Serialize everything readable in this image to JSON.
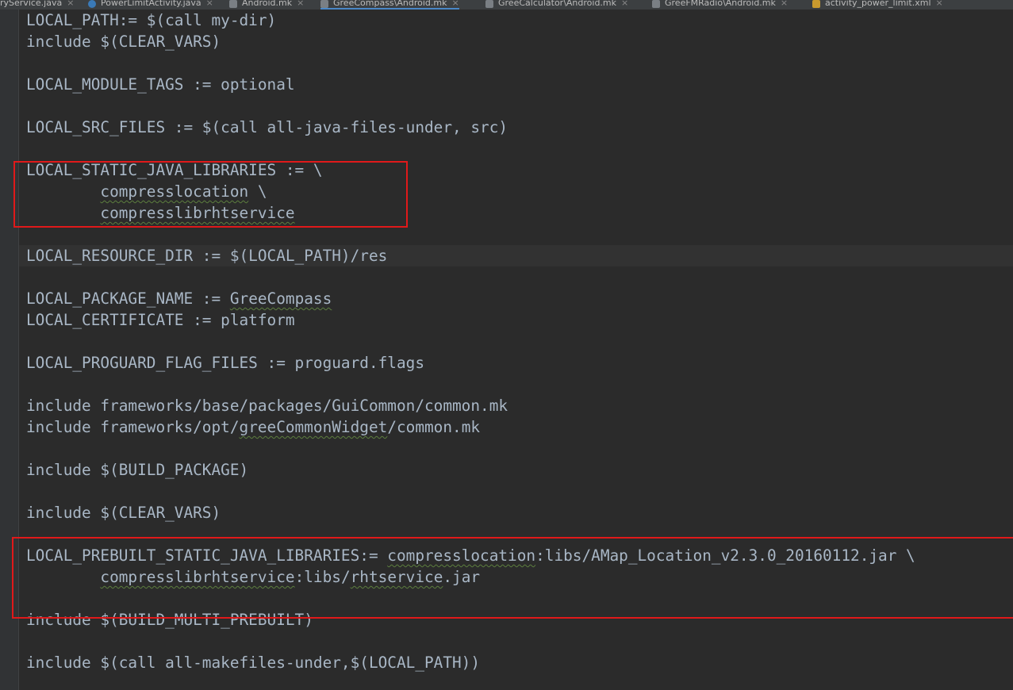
{
  "tabs": [
    {
      "label": "ryService.java",
      "icon": "java-file-icon",
      "active": false
    },
    {
      "label": "PowerLimitActivity.java",
      "icon": "java-class-icon",
      "active": false
    },
    {
      "label": "Android.mk",
      "icon": "makefile-icon",
      "active": false
    },
    {
      "label": "GreeCompass\\Android.mk",
      "icon": "makefile-icon",
      "active": true
    },
    {
      "label": "GreeCalculator\\Android.mk",
      "icon": "makefile-icon",
      "active": false
    },
    {
      "label": "GreeFMRadio\\Android.mk",
      "icon": "makefile-icon",
      "active": false
    },
    {
      "label": "activity_power_limit.xml",
      "icon": "xml-file-icon",
      "active": false
    }
  ],
  "close_glyph": "×",
  "code": {
    "l1": "LOCAL_PATH:= $(call my-dir)",
    "l2": "include $(CLEAR_VARS)",
    "l4": "LOCAL_MODULE_TAGS := optional",
    "l6": "LOCAL_SRC_FILES := $(call all-java-files-under, src)",
    "l8": "LOCAL_STATIC_JAVA_LIBRARIES := \\",
    "l9_indent": "        ",
    "l9_a": "compresslocation",
    "l9_b": " \\",
    "l10_indent": "        ",
    "l10_a": "compresslibrhtservice",
    "l12": "LOCAL_RESOURCE_DIR := $(LOCAL_PATH)/res",
    "l14_a": "LOCAL_PACKAGE_NAME := ",
    "l14_b": "GreeCompass",
    "l15": "LOCAL_CERTIFICATE := platform",
    "l17": "LOCAL_PROGUARD_FLAG_FILES := proguard.flags",
    "l19": "include frameworks/base/packages/GuiCommon/common.mk",
    "l20_a": "include frameworks/opt/",
    "l20_b": "greeCommonWidget",
    "l20_c": "/common.mk",
    "l22": "include $(BUILD_PACKAGE)",
    "l24": "include $(CLEAR_VARS)",
    "l26_a": "LOCAL_PREBUILT_STATIC_JAVA_LIBRARIES:= ",
    "l26_b": "compresslocation",
    "l26_c": ":libs/AMap_Location_v2.3.0_20160112.jar \\",
    "l27_indent": "        ",
    "l27_a": "compresslibrhtservice",
    "l27_b": ":libs/",
    "l27_c": "rhtservice",
    "l27_d": ".jar",
    "l29": "include $(BUILD_MULTI_PREBUILT)",
    "l31": "include $(call all-makefiles-under,$(LOCAL_PATH))"
  },
  "colors": {
    "background": "#2b2b2b",
    "text": "#a9b7c6",
    "highlight_box": "#e0191a",
    "current_line": "#323232",
    "tab_bar": "#3c3f41",
    "active_tab_underline": "#4a88c7"
  }
}
